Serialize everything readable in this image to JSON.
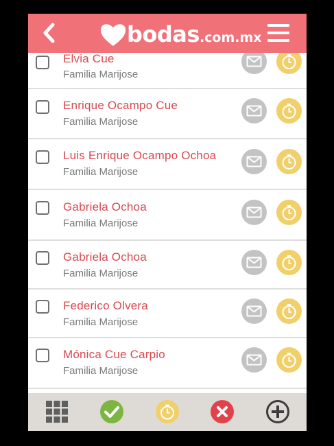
{
  "header": {
    "brand_main": "bodas",
    "brand_tld": ".com.mx",
    "back_icon": "chevron-left-icon",
    "menu_icon": "hamburger-menu-icon",
    "color": "#f07178"
  },
  "guests": [
    {
      "name": "Elvia Cue",
      "group": "Familia Marijose"
    },
    {
      "name": "Enrique Ocampo Cue",
      "group": "Familia Marijose"
    },
    {
      "name": "Luis Enrique Ocampo Ochoa",
      "group": "Familia Marijose"
    },
    {
      "name": "Gabriela Ochoa",
      "group": "Familia Marijose"
    },
    {
      "name": "Gabriela Ochoa",
      "group": "Familia Marijose"
    },
    {
      "name": "Federico Olvera",
      "group": "Familia Marijose"
    },
    {
      "name": "Mónica Cue Carpio",
      "group": "Familia Marijose"
    }
  ],
  "row_actions": {
    "mail_icon": "envelope-icon",
    "pending_icon": "stopwatch-icon",
    "mail_color": "#c3c3c3",
    "pending_color": "#f1cf69"
  },
  "footer": {
    "items": [
      {
        "icon": "grid-icon",
        "color": "#5f5f5f"
      },
      {
        "icon": "check-circle-icon",
        "color": "#7db541"
      },
      {
        "icon": "stopwatch-circle-icon",
        "color": "#f1cf69"
      },
      {
        "icon": "x-circle-icon",
        "color": "#e2434b"
      },
      {
        "icon": "plus-circle-icon",
        "color": "#3c3c3c"
      }
    ]
  },
  "colors": {
    "name_text": "#d9484f",
    "group_text": "#7b7b7b",
    "footer_bg": "#dedad5"
  }
}
